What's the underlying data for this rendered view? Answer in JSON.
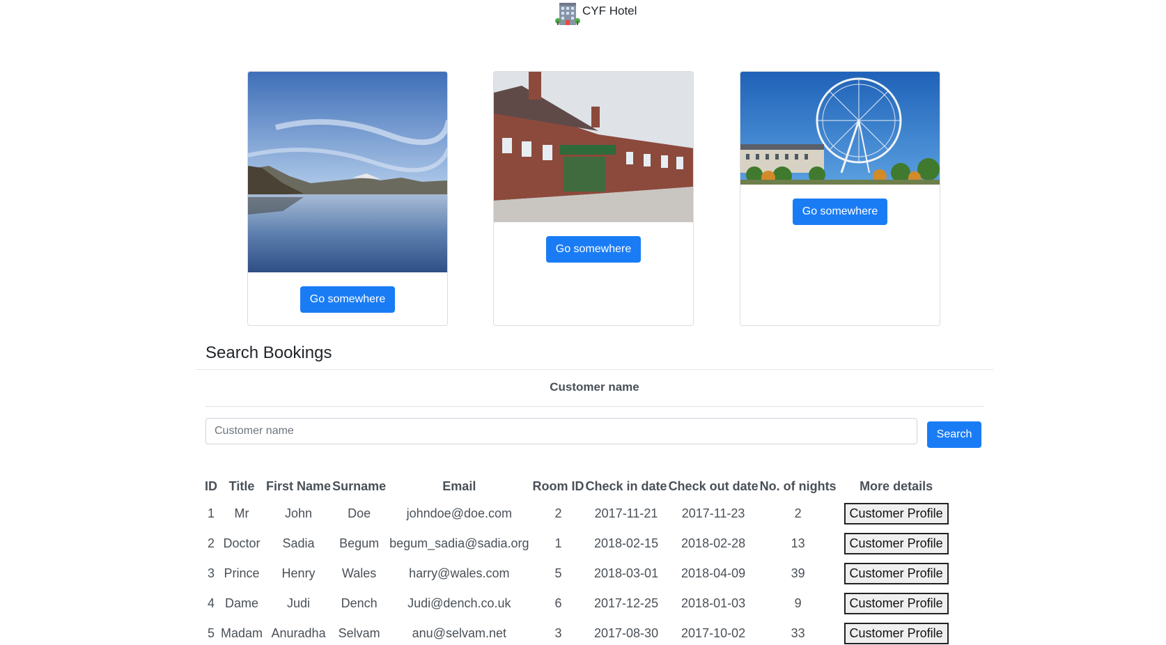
{
  "header": {
    "brand": "CYF Hotel",
    "logo_icon": "hotel-building-icon"
  },
  "cards": [
    {
      "image": "lake-mountains-photo",
      "button_label": "Go somewhere"
    },
    {
      "image": "brick-terrace-street-photo",
      "button_label": "Go somewhere"
    },
    {
      "image": "ferris-wheel-photo",
      "button_label": "Go somewhere"
    }
  ],
  "search": {
    "title": "Search Bookings",
    "field_label": "Customer name",
    "input_placeholder": "Customer name",
    "input_value": "",
    "button_label": "Search"
  },
  "table": {
    "headers": [
      "ID",
      "Title",
      "First Name",
      "Surname",
      "Email",
      "Room ID",
      "Check in date",
      "Check out date",
      "No. of nights",
      "More details"
    ],
    "rows": [
      {
        "id": "1",
        "title": "Mr",
        "first_name": "John",
        "surname": "Doe",
        "email": "johndoe@doe.com",
        "room_id": "2",
        "check_in": "2017-11-21",
        "check_out": "2017-11-23",
        "nights": "2",
        "action": "Customer Profile"
      },
      {
        "id": "2",
        "title": "Doctor",
        "first_name": "Sadia",
        "surname": "Begum",
        "email": "begum_sadia@sadia.org",
        "room_id": "1",
        "check_in": "2018-02-15",
        "check_out": "2018-02-28",
        "nights": "13",
        "action": "Customer Profile"
      },
      {
        "id": "3",
        "title": "Prince",
        "first_name": "Henry",
        "surname": "Wales",
        "email": "harry@wales.com",
        "room_id": "5",
        "check_in": "2018-03-01",
        "check_out": "2018-04-09",
        "nights": "39",
        "action": "Customer Profile"
      },
      {
        "id": "4",
        "title": "Dame",
        "first_name": "Judi",
        "surname": "Dench",
        "email": "Judi@dench.co.uk",
        "room_id": "6",
        "check_in": "2017-12-25",
        "check_out": "2018-01-03",
        "nights": "9",
        "action": "Customer Profile"
      },
      {
        "id": "5",
        "title": "Madam",
        "first_name": "Anuradha",
        "surname": "Selvam",
        "email": "anu@selvam.net",
        "room_id": "3",
        "check_in": "2017-08-30",
        "check_out": "2017-10-02",
        "nights": "33",
        "action": "Customer Profile"
      }
    ]
  },
  "colors": {
    "primary": "#1a7cf5",
    "text": "#495057"
  }
}
